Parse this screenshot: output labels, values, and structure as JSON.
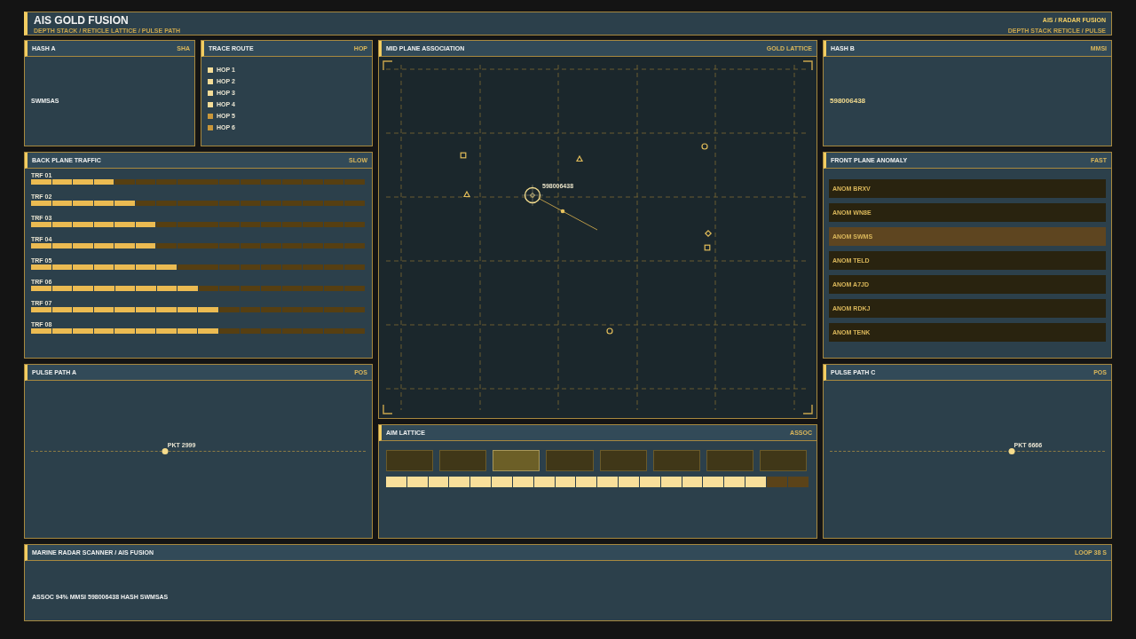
{
  "header": {
    "title": "AIS GOLD FUSION",
    "subtitle": "DEPTH STACK / RETICLE LATTICE / PULSE PATH",
    "right_title": "AIS / RADAR FUSION",
    "right_subtitle": "DEPTH STACK RETICLE / PULSE"
  },
  "hash_a": {
    "title": "HASH A",
    "badge": "SHA",
    "value": "SWMSAS"
  },
  "trace_route": {
    "title": "TRACE ROUTE",
    "badge": "HOP",
    "hops": [
      {
        "label": "HOP 1",
        "active": true
      },
      {
        "label": "HOP 2",
        "active": true
      },
      {
        "label": "HOP 3",
        "active": true
      },
      {
        "label": "HOP 4",
        "active": true
      },
      {
        "label": "HOP 5",
        "active": false
      },
      {
        "label": "HOP 6",
        "active": false
      }
    ]
  },
  "back_plane_traffic": {
    "title": "BACK PLANE TRAFFIC",
    "badge": "SLOW",
    "rows": [
      {
        "label": "TRF 01",
        "level": 0.25
      },
      {
        "label": "TRF 02",
        "level": 0.3125
      },
      {
        "label": "TRF 03",
        "level": 0.375
      },
      {
        "label": "TRF 04",
        "level": 0.375
      },
      {
        "label": "TRF 05",
        "level": 0.4375
      },
      {
        "label": "TRF 06",
        "level": 0.5
      },
      {
        "label": "TRF 07",
        "level": 0.5625
      },
      {
        "label": "TRF 08",
        "level": 0.5625
      }
    ]
  },
  "pulse_path_a": {
    "title": "PULSE PATH A",
    "badge": "POS",
    "marker_label": "PKT 2999",
    "level": 0.4
  },
  "mid_plane": {
    "title": "MID PLANE ASSOCIATION",
    "badge": "GOLD LATTICE",
    "target_label": "598006438",
    "contacts": [
      {
        "kind": "square"
      },
      {
        "kind": "triangle"
      },
      {
        "kind": "circle"
      },
      {
        "kind": "triangle"
      },
      {
        "kind": "diamond"
      },
      {
        "kind": "square"
      },
      {
        "kind": "circle"
      }
    ]
  },
  "aim_lattice": {
    "title": "AIM LATTICE",
    "badge": "ASSOC",
    "cells": [
      {
        "selected": false
      },
      {
        "selected": false
      },
      {
        "selected": true
      },
      {
        "selected": false
      },
      {
        "selected": false
      },
      {
        "selected": false
      },
      {
        "selected": false
      },
      {
        "selected": false
      }
    ],
    "level": 0.9
  },
  "hash_b": {
    "title": "HASH B",
    "badge": "MMSI",
    "value": "598006438"
  },
  "front_plane_anomaly": {
    "title": "FRONT PLANE ANOMALY",
    "badge": "FAST",
    "items": [
      {
        "label": "ANOM BRXV",
        "selected": false
      },
      {
        "label": "ANOM WN8E",
        "selected": false
      },
      {
        "label": "ANOM SWMS",
        "selected": true
      },
      {
        "label": "ANOM TELD",
        "selected": false
      },
      {
        "label": "ANOM A7JD",
        "selected": false
      },
      {
        "label": "ANOM RDKJ",
        "selected": false
      },
      {
        "label": "ANOM TENK",
        "selected": false
      }
    ]
  },
  "pulse_path_c": {
    "title": "PULSE PATH C",
    "badge": "POS",
    "marker_label": "PKT 6666",
    "level": 0.66
  },
  "footer": {
    "title": "MARINE RADAR SCANNER / AIS FUSION",
    "badge": "LOOP 38 S",
    "status": "ASSOC 94% MMSI 598006438 HASH SWMSAS"
  }
}
